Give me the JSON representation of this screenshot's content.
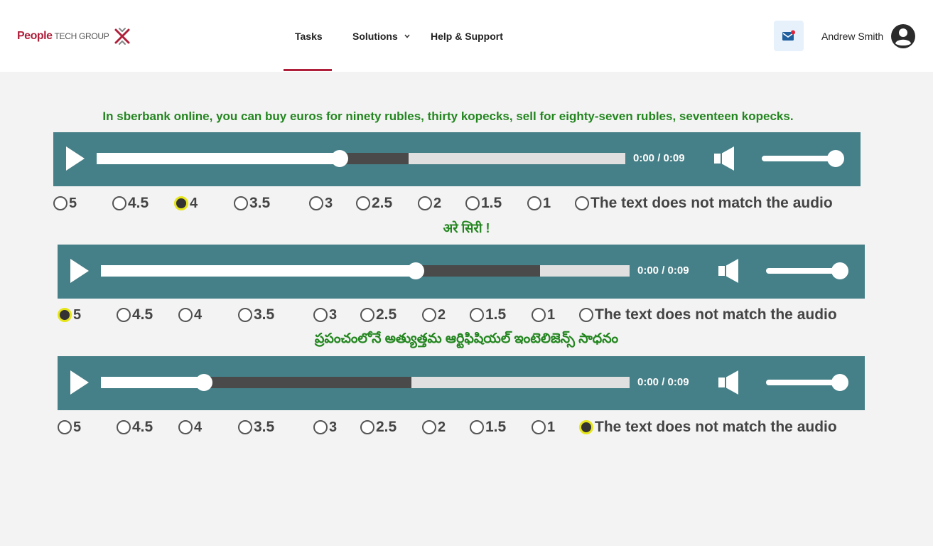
{
  "header": {
    "logo": {
      "primary": "People",
      "secondary": "TECH GROUP"
    },
    "nav": [
      {
        "label": "Tasks",
        "active": true
      },
      {
        "label": "Solutions",
        "has_dropdown": true
      },
      {
        "label": "Help & Support"
      }
    ],
    "user_name": "Andrew Smith",
    "icons": {
      "mail": "mail-icon",
      "avatar": "account-circle-icon"
    },
    "colors": {
      "brand": "#b01f3a"
    }
  },
  "items": [
    {
      "caption": "In sberbank online, you can buy euros for ninety rubles, thirty kopecks, sell for eighty-seven rubles, seventeen kopecks.",
      "time": "0:00 / 0:09",
      "progress_fraction": 0.46,
      "buffered_fraction": 0.59,
      "volume_fraction": 1.0,
      "selected": "4"
    },
    {
      "caption": "अरे सिरी !",
      "time": "0:00 / 0:09",
      "progress_fraction": 0.596,
      "buffered_fraction": 0.83,
      "volume_fraction": 1.0,
      "selected": "5"
    },
    {
      "caption": "ప్రపంచంలోనే అత్యుత్తమ ఆర్టిఫిషియల్ ఇంటెలిజెన్స్ సాధనం",
      "time": "0:00 / 0:09",
      "progress_fraction": 0.195,
      "buffered_fraction": 0.588,
      "volume_fraction": 1.0,
      "selected": "The text does not match the audio"
    }
  ],
  "rating_options": [
    "5",
    "4.5",
    "4",
    "3.5",
    "3",
    "2.5",
    "2",
    "1.5",
    "1",
    "The text does not match the audio"
  ],
  "colors": {
    "player_bg": "#457f87",
    "caption": "#23861f",
    "radio_selected_ring": "#e5e51a"
  }
}
